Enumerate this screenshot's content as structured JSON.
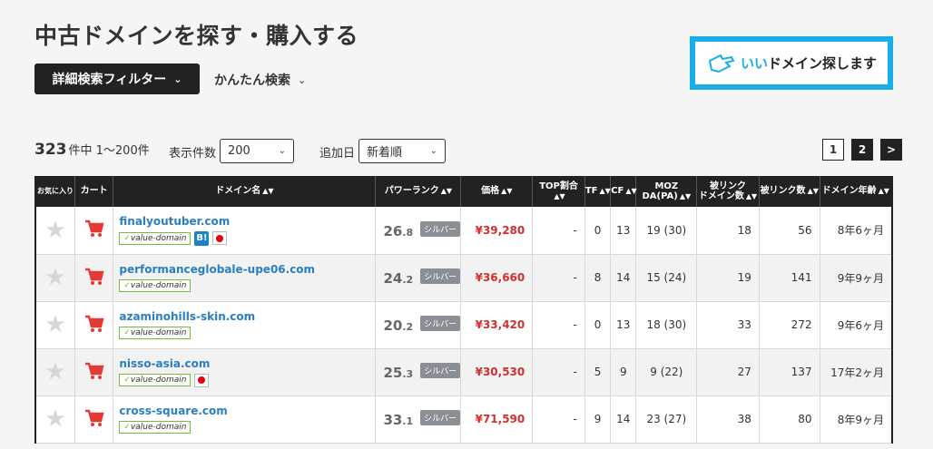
{
  "page": {
    "title": "中古ドメインを探す・購入する"
  },
  "filters": {
    "advanced_label": "詳細検索フィルター",
    "simple_label": "かんたん検索"
  },
  "banner": {
    "text_prefix": "いい",
    "text_main": "ドメイン探します"
  },
  "results": {
    "count": "323",
    "count_suffix": "件中 1〜200件",
    "per_page_label": "表示件数",
    "per_page_value": "200",
    "sort_label": "追加日",
    "sort_value": "新着順"
  },
  "pager": {
    "pages": [
      "1",
      "2"
    ],
    "next": ">"
  },
  "table": {
    "headers": {
      "fav": "お気に入り",
      "cart": "カート",
      "domain": "ドメイン名",
      "power": "パワーランク",
      "price": "価格",
      "top": "TOP割合",
      "tf": "TF",
      "cf": "CF",
      "moz_1": "MOZ",
      "moz_2": "DA(PA)",
      "ref_domains_1": "被リンク",
      "ref_domains_2": "ドメイン数",
      "backlinks": "被リンク数",
      "age": "ドメイン年齢"
    },
    "rows": [
      {
        "domain": "finalyoutuber.com",
        "vd": "value-domain",
        "hb": "B!",
        "jp": true,
        "rank_int": "26",
        "rank_dec": ".8",
        "rank_badge": "シルバー",
        "price": "¥39,280",
        "top": "-",
        "tf": "0",
        "cf": "13",
        "moz": "19 (30)",
        "ref": "18",
        "bl": "56",
        "age": "8年6ヶ月"
      },
      {
        "domain": "performanceglobale-upe06.com",
        "vd": "value-domain",
        "hb": "",
        "jp": false,
        "rank_int": "24",
        "rank_dec": ".2",
        "rank_badge": "シルバー",
        "price": "¥36,660",
        "top": "-",
        "tf": "8",
        "cf": "14",
        "moz": "15 (24)",
        "ref": "19",
        "bl": "141",
        "age": "9年9ヶ月"
      },
      {
        "domain": "azaminohills-skin.com",
        "vd": "value-domain",
        "hb": "",
        "jp": false,
        "rank_int": "20",
        "rank_dec": ".2",
        "rank_badge": "シルバー",
        "price": "¥33,420",
        "top": "-",
        "tf": "0",
        "cf": "13",
        "moz": "18 (30)",
        "ref": "33",
        "bl": "272",
        "age": "9年6ヶ月"
      },
      {
        "domain": "nisso-asia.com",
        "vd": "value-domain",
        "hb": "",
        "jp": true,
        "rank_int": "25",
        "rank_dec": ".3",
        "rank_badge": "シルバー",
        "price": "¥30,530",
        "top": "-",
        "tf": "5",
        "cf": "9",
        "moz": "9 (22)",
        "ref": "27",
        "bl": "137",
        "age": "17年2ヶ月"
      },
      {
        "domain": "cross-square.com",
        "vd": "value-domain",
        "hb": "",
        "jp": false,
        "rank_int": "33",
        "rank_dec": ".1",
        "rank_badge": "シルバー",
        "price": "¥71,590",
        "top": "-",
        "tf": "9",
        "cf": "14",
        "moz": "23 (27)",
        "ref": "38",
        "bl": "80",
        "age": "8年9ヶ月"
      }
    ]
  }
}
